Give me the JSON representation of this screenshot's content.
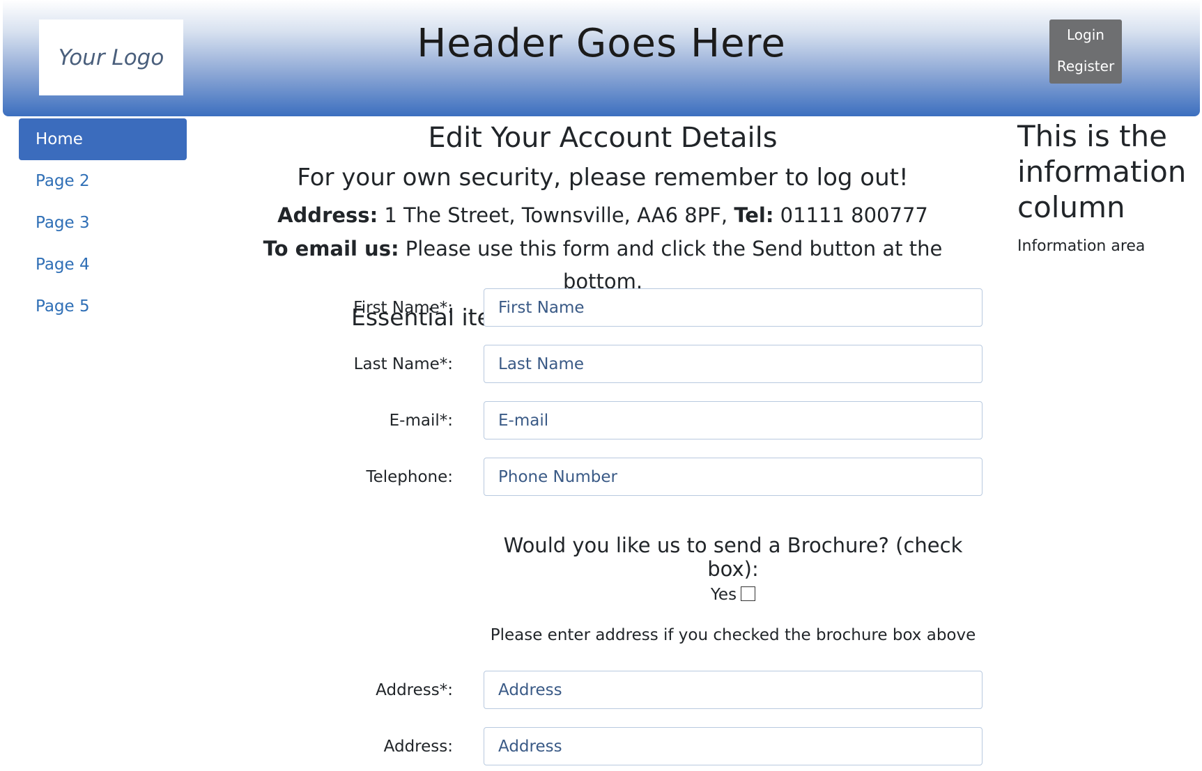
{
  "header": {
    "logo_text": "Your Logo",
    "title": "Header Goes Here",
    "login_label": "Login",
    "register_label": "Register",
    "gradient_colors": [
      "#ffffff",
      "#3c6fbf"
    ]
  },
  "nav": {
    "items": [
      {
        "label": "Home",
        "active": true
      },
      {
        "label": "Page 2",
        "active": false
      },
      {
        "label": "Page 3",
        "active": false
      },
      {
        "label": "Page 4",
        "active": false
      },
      {
        "label": "Page 5",
        "active": false
      }
    ],
    "active_color": "#3b6cbd",
    "link_color": "#2f6fb6"
  },
  "main": {
    "title": "Edit Your Account Details",
    "security_notice": "For your own security, please remember to log out!",
    "address_label": "Address:",
    "address_value": " 1 The Street, Townsville, AA6 8PF, ",
    "tel_label": "Tel:",
    "tel_value": " 01111 800777",
    "email_label": "To email us:",
    "email_text": " Please use this form and click the Send button at the bottom.",
    "essentials_note": "Essential items are marked with an asterisk"
  },
  "form": {
    "first_name": {
      "label": "First Name*:",
      "placeholder": "First Name"
    },
    "last_name": {
      "label": "Last Name*:",
      "placeholder": "Last Name"
    },
    "email": {
      "label": "E-mail*:",
      "placeholder": "E-mail"
    },
    "telephone": {
      "label": "Telephone:",
      "placeholder": "Phone Number"
    },
    "brochure_question": "Would you like us to send a Brochure? (check box):",
    "brochure_yes_label": "Yes",
    "address_note": "Please enter address if you checked the brochure box above",
    "address1": {
      "label": "Address*:",
      "placeholder": "Address"
    },
    "address2": {
      "label": "Address:",
      "placeholder": "Address"
    }
  },
  "info": {
    "title": "This is the information column",
    "text": "Information area"
  }
}
